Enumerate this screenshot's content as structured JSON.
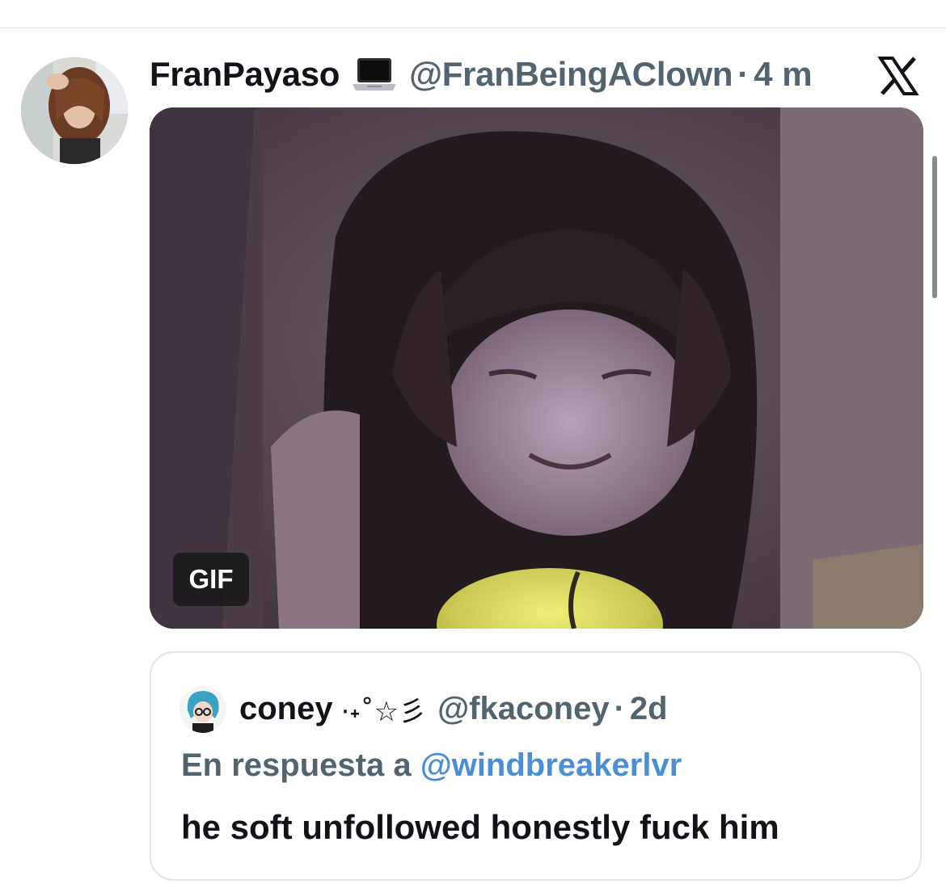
{
  "post": {
    "display_name": "FranPayaso",
    "handle": "@FranBeingAClown",
    "separator": "·",
    "time": "4 m",
    "media_badge": "GIF",
    "icons": {
      "name_emoji": "laptop-icon",
      "brand": "x-logo-icon"
    }
  },
  "quote": {
    "display_name": "coney",
    "name_decoration": "·˖˚☆彡",
    "handle": "@fkaconey",
    "separator": "·",
    "time": "2d",
    "reply_prefix": "En respuesta a",
    "reply_to": "@windbreakerlvr",
    "text": "he soft unfollowed honestly fuck him"
  },
  "colors": {
    "text_primary": "#0f1419",
    "text_secondary": "#536471",
    "link": "#4a8fd6",
    "border": "#e1e6ea"
  }
}
